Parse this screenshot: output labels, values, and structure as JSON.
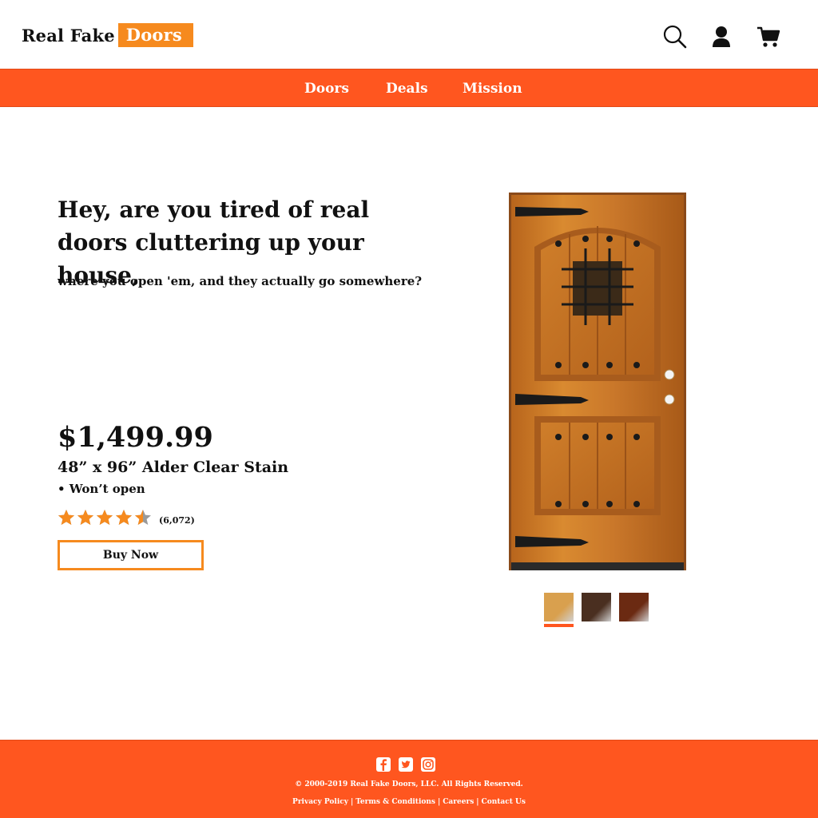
{
  "header": {
    "logo_plain": "Real Fake",
    "logo_boxed": "Doors",
    "icons": [
      "search-icon",
      "user-icon",
      "cart-icon"
    ]
  },
  "nav": {
    "items": [
      {
        "label": "Doors"
      },
      {
        "label": "Deals"
      },
      {
        "label": "Mission"
      }
    ]
  },
  "hero": {
    "headline": "Hey, are you tired of real doors cluttering up your house,",
    "subline": "where you open 'em, and they actually go somewhere?"
  },
  "product": {
    "price": "$1,499.99",
    "name": "48” x 96” Alder Clear Stain",
    "feature": "• Won’t open",
    "rating": 4.5,
    "rating_max": 5,
    "review_count": "(6,072)",
    "buy_label": "Buy Now",
    "swatches": [
      {
        "name": "light-oak",
        "color": "#d9a04e",
        "selected": true
      },
      {
        "name": "dark-walnut",
        "color": "#4a2f20",
        "selected": false
      },
      {
        "name": "mahogany",
        "color": "#6b2a12",
        "selected": false
      }
    ]
  },
  "footer": {
    "social_icons": [
      "facebook-icon",
      "twitter-icon",
      "instagram-icon"
    ],
    "copyright": "© 2000-2019 Real Fake Doors, LLC. All Rights Reserved.",
    "links": [
      {
        "label": "Privacy Policy"
      },
      {
        "label": "Terms & Conditions"
      },
      {
        "label": "Careers"
      },
      {
        "label": "Contact Us"
      }
    ]
  },
  "colors": {
    "brand_orange": "#ff561f",
    "accent_orange": "#f68a1e",
    "star_gray": "#9a9a9a"
  }
}
